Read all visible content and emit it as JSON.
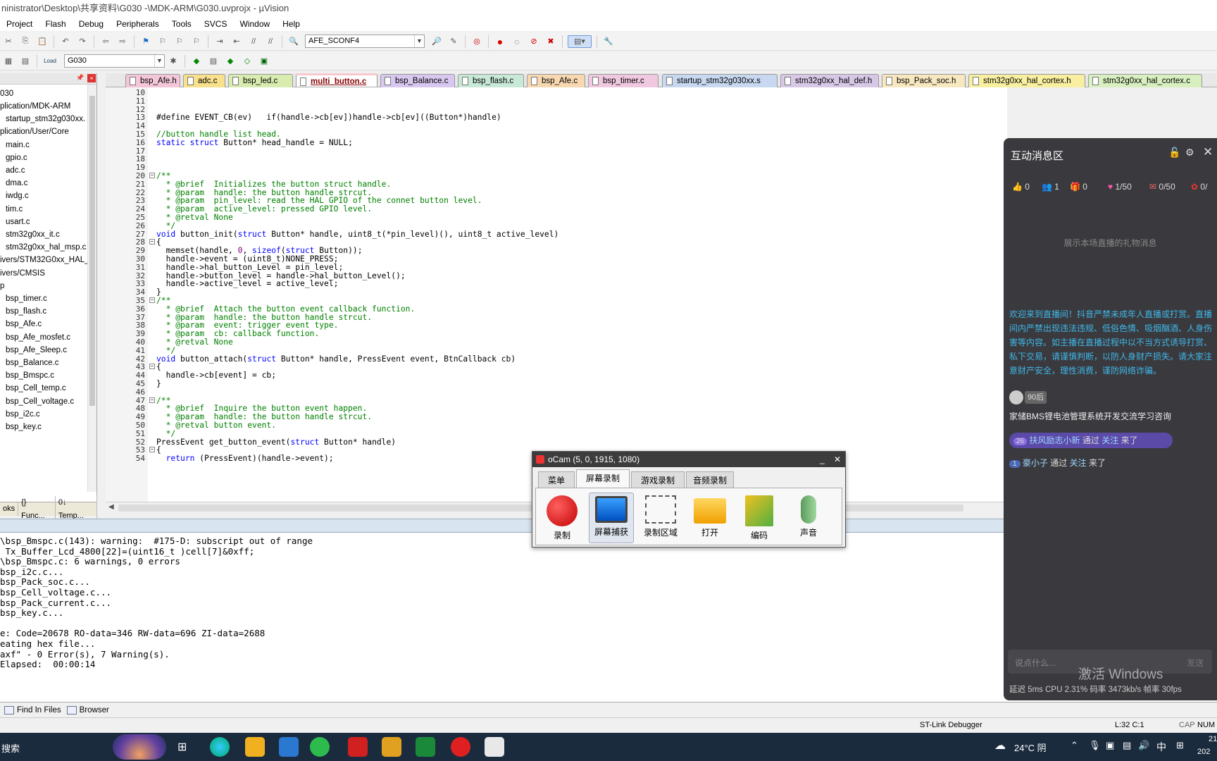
{
  "window": {
    "title": "ninistrator\\Desktop\\共享资料\\G030 -\\MDK-ARM\\G030.uvprojx - µVision"
  },
  "menu": [
    "Project",
    "Flash",
    "Debug",
    "Peripherals",
    "Tools",
    "SVCS",
    "Window",
    "Help"
  ],
  "toolbar": {
    "target_combo": "AFE_SCONF4",
    "project_combo": "G030",
    "load_label": "Load"
  },
  "project": {
    "root": "030",
    "items": [
      {
        "label": "plication/MDK-ARM",
        "indent": 0
      },
      {
        "label": "startup_stm32g030xx.",
        "indent": 1
      },
      {
        "label": "plication/User/Core",
        "indent": 0
      },
      {
        "label": "main.c",
        "indent": 1
      },
      {
        "label": "gpio.c",
        "indent": 1
      },
      {
        "label": "adc.c",
        "indent": 1
      },
      {
        "label": "dma.c",
        "indent": 1
      },
      {
        "label": "iwdg.c",
        "indent": 1
      },
      {
        "label": "tim.c",
        "indent": 1
      },
      {
        "label": "usart.c",
        "indent": 1
      },
      {
        "label": "stm32g0xx_it.c",
        "indent": 1
      },
      {
        "label": "stm32g0xx_hal_msp.c",
        "indent": 1
      },
      {
        "label": "ivers/STM32G0xx_HAL_",
        "indent": 0
      },
      {
        "label": "ivers/CMSIS",
        "indent": 0
      },
      {
        "label": "p",
        "indent": 0
      },
      {
        "label": "bsp_timer.c",
        "indent": 1
      },
      {
        "label": "bsp_flash.c",
        "indent": 1
      },
      {
        "label": "bsp_Afe.c",
        "indent": 1
      },
      {
        "label": "bsp_Afe_mosfet.c",
        "indent": 1
      },
      {
        "label": "bsp_Afe_Sleep.c",
        "indent": 1
      },
      {
        "label": "bsp_Balance.c",
        "indent": 1
      },
      {
        "label": "bsp_Bmspc.c",
        "indent": 1
      },
      {
        "label": "bsp_Cell_temp.c",
        "indent": 1
      },
      {
        "label": "bsp_Cell_voltage.c",
        "indent": 1
      },
      {
        "label": "bsp_i2c.c",
        "indent": 1
      },
      {
        "label": "bsp_key.c",
        "indent": 1
      }
    ],
    "tabs": [
      "oks",
      "{} Func...",
      "0↓ Temp..."
    ]
  },
  "file_tabs": [
    {
      "label": "bsp_Afe.h",
      "color": "#f4c6d8"
    },
    {
      "label": "adc.c",
      "color": "#f8e08c"
    },
    {
      "label": "bsp_led.c",
      "color": "#d8ecb0"
    },
    {
      "label": "multi_button.c",
      "color": "#f8c8d0",
      "active": true
    },
    {
      "label": "bsp_Balance.c",
      "color": "#d8c8f0"
    },
    {
      "label": "bsp_flash.c",
      "color": "#c8e8d8"
    },
    {
      "label": "bsp_Afe.c",
      "color": "#f8d8b0"
    },
    {
      "label": "bsp_timer.c",
      "color": "#f0c8e0"
    },
    {
      "label": "startup_stm32g030xx.s",
      "color": "#c8d8f0"
    },
    {
      "label": "stm32g0xx_hal_def.h",
      "color": "#d8c8e8"
    },
    {
      "label": "bsp_Pack_soc.h",
      "color": "#f8e8c0"
    },
    {
      "label": "stm32g0xx_hal_cortex.h",
      "color": "#f8f0a0"
    },
    {
      "label": "stm32g0xx_hal_cortex.c",
      "color": "#d8f0c0"
    }
  ],
  "code": [
    {
      "n": "10",
      "t": ""
    },
    {
      "n": "11",
      "t": ""
    },
    {
      "n": "12",
      "t": ""
    },
    {
      "n": "13",
      "t": "#define EVENT_CB(ev)   if(handle->cb[ev])handle->cb[ev]((Button*)handle)"
    },
    {
      "n": "14",
      "t": ""
    },
    {
      "n": "15",
      "t": "//button handle list head.",
      "c": "cm"
    },
    {
      "n": "16",
      "t": "static struct Button* head_handle = NULL;"
    },
    {
      "n": "17",
      "t": ""
    },
    {
      "n": "18",
      "t": ""
    },
    {
      "n": "19",
      "t": ""
    },
    {
      "n": "20",
      "t": "/**",
      "c": "cm",
      "fold": true
    },
    {
      "n": "21",
      "t": "  * @brief  Initializes the button struct handle.",
      "c": "cm"
    },
    {
      "n": "22",
      "t": "  * @param  handle: the button handle strcut.",
      "c": "cm"
    },
    {
      "n": "23",
      "t": "  * @param  pin_level: read the HAL GPIO of the connet button level.",
      "c": "cm"
    },
    {
      "n": "24",
      "t": "  * @param  active_level: pressed GPIO level.",
      "c": "cm"
    },
    {
      "n": "25",
      "t": "  * @retval None",
      "c": "cm"
    },
    {
      "n": "26",
      "t": "  */",
      "c": "cm"
    },
    {
      "n": "27",
      "t": "void button_init(struct Button* handle, uint8_t(*pin_level)(), uint8_t active_level)"
    },
    {
      "n": "28",
      "t": "{",
      "fold": true
    },
    {
      "n": "29",
      "t": "  memset(handle, 0, sizeof(struct Button));"
    },
    {
      "n": "30",
      "t": "  handle->event = (uint8_t)NONE_PRESS;"
    },
    {
      "n": "31",
      "t": "  handle->hal_button_Level = pin_level;"
    },
    {
      "n": "32",
      "t": "  handle->button_level = handle->hal_button_Level();"
    },
    {
      "n": "33",
      "t": "  handle->active_level = active_level;"
    },
    {
      "n": "34",
      "t": "}"
    },
    {
      "n": "35",
      "t": "/**",
      "c": "cm",
      "fold": true
    },
    {
      "n": "36",
      "t": "  * @brief  Attach the button event callback function.",
      "c": "cm"
    },
    {
      "n": "37",
      "t": "  * @param  handle: the button handle strcut.",
      "c": "cm"
    },
    {
      "n": "38",
      "t": "  * @param  event: trigger event type.",
      "c": "cm"
    },
    {
      "n": "39",
      "t": "  * @param  cb: callback function.",
      "c": "cm"
    },
    {
      "n": "40",
      "t": "  * @retval None",
      "c": "cm"
    },
    {
      "n": "41",
      "t": "  */",
      "c": "cm"
    },
    {
      "n": "42",
      "t": "void button_attach(struct Button* handle, PressEvent event, BtnCallback cb)"
    },
    {
      "n": "43",
      "t": "{",
      "fold": true
    },
    {
      "n": "44",
      "t": "  handle->cb[event] = cb;"
    },
    {
      "n": "45",
      "t": "}"
    },
    {
      "n": "46",
      "t": ""
    },
    {
      "n": "47",
      "t": "/**",
      "c": "cm",
      "fold": true
    },
    {
      "n": "48",
      "t": "  * @brief  Inquire the button event happen.",
      "c": "cm"
    },
    {
      "n": "49",
      "t": "  * @param  handle: the button handle strcut.",
      "c": "cm"
    },
    {
      "n": "50",
      "t": "  * @retval button event.",
      "c": "cm"
    },
    {
      "n": "51",
      "t": "  */",
      "c": "cm"
    },
    {
      "n": "52",
      "t": "PressEvent get_button_event(struct Button* handle)"
    },
    {
      "n": "53",
      "t": "{",
      "fold": true
    },
    {
      "n": "54",
      "t": "  return (PressEvent)(handle->event);"
    }
  ],
  "output": [
    "\\bsp_Bmspc.c(143): warning:  #175-D: subscript out of range",
    " Tx_Buffer_Lcd_4800[22]=(uint16_t )cell[7]&0xff;",
    "\\bsp_Bmspc.c: 6 warnings, 0 errors",
    "bsp_i2c.c...",
    "bsp_Pack_soc.c...",
    "bsp_Cell_voltage.c...",
    "bsp_Pack_current.c...",
    "bsp_key.c...",
    "",
    "e: Code=20678 RO-data=346 RW-data=696 ZI-data=2688",
    "eating hex file...",
    "axf\" - 0 Error(s), 7 Warning(s).",
    "Elapsed:  00:00:14"
  ],
  "output_tabs": [
    "Find In Files",
    "Browser"
  ],
  "status": {
    "debugger": "ST-Link Debugger",
    "position": "L:32 C:1",
    "caps": "CAP",
    "num": "NUM"
  },
  "chat": {
    "title": "互动消息区",
    "likes": "0",
    "users": "1",
    "gifts": "0",
    "fans": "1/50",
    "red1": "0/50",
    "red2": "0/",
    "gift_placeholder": "展示本场直播的礼物消息",
    "notice": "欢迎来到直播间！抖音严禁未成年人直播或打赏。直播间内严禁出现违法违规、低俗色情、吸烟酗酒、人身伤害等内容。如主播在直播过程中以不当方式诱导打赏、私下交易，请谨慎判断，以防人身财产损失。请大家注意财产安全，理性消费，谨防网络诈骗。",
    "badge": "90后",
    "room": "家储BMS锂电池管理系统开发交流学习咨询",
    "msg1_level": "26",
    "msg1_user": "扶风励志小新",
    "msg1_via": "通过",
    "msg1_follow": "关注",
    "msg1_tail": "来了",
    "msg2_level": "1",
    "msg2_user": "豪小子",
    "msg2_via": "通过",
    "msg2_follow": "关注",
    "msg2_tail": "来了",
    "input_placeholder": "说点什么...",
    "send": "发送",
    "stats": "延迟 5ms   CPU 2.31%   码率 3473kb/s   帧率 30fps",
    "watermark": "激活 Windows"
  },
  "ocam": {
    "title": "oCam (5, 0, 1915, 1080)",
    "tabs": [
      "菜单",
      "屏幕录制",
      "游戏录制",
      "音频录制"
    ],
    "buttons": [
      "录制",
      "屏幕捕获",
      "录制区域",
      "打开",
      "编码",
      "声音"
    ]
  },
  "taskbar": {
    "search": "搜索",
    "weather": "24°C  阴",
    "ime": "中",
    "clock": "21",
    "year": "202"
  }
}
